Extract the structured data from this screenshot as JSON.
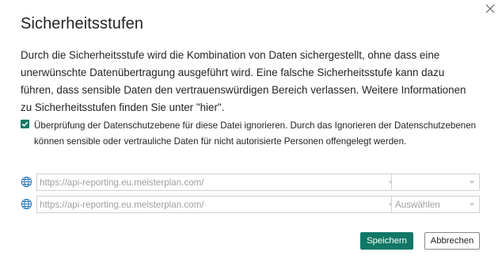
{
  "dialog": {
    "title": "Sicherheitsstufen",
    "description": "Durch die Sicherheitsstufe wird die Kombination von Daten sichergestellt, ohne dass eine unerwünschte Datenübertragung ausgeführt wird. Eine falsche Sicherheitsstufe kann dazu führen, dass sensible Daten den vertrauenswürdigen Bereich verlassen. Weitere Informationen zu Sicherheitsstufen finden Sie unter \"hier\".",
    "close_icon": "close-icon"
  },
  "ignore_privacy": {
    "checked": true,
    "label": "Überprüfung der Datenschutzebene für diese Datei ignorieren. Durch das Ignorieren der Datenschutzebenen können sensible oder vertrauliche Daten für nicht autorisierte Personen offengelegt werden."
  },
  "sources": [
    {
      "icon": "globe-icon",
      "url": "https://api-reporting.eu.meisterplan.com/",
      "level": ""
    },
    {
      "icon": "globe-icon",
      "url": "https://api-reporting.eu.meisterplan.com/",
      "level": "Auswählen"
    }
  ],
  "buttons": {
    "save_label": "Speichern",
    "cancel_label": "Abbrechen"
  },
  "colors": {
    "accent": "#117865",
    "text": "#252423",
    "disabled_text": "#a19f9d",
    "border": "#d2d0ce",
    "globe": "#1a6fb5"
  }
}
